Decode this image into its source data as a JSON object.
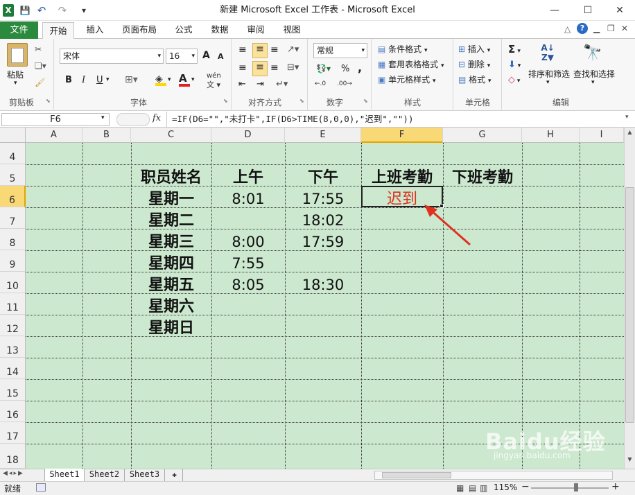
{
  "window": {
    "title": "新建 Microsoft Excel 工作表 - Microsoft Excel",
    "minimize": "—",
    "maximize": "☐",
    "close": "✕"
  },
  "qat": {
    "app_icon": "X",
    "save": "💾",
    "undo": "↶",
    "redo": "↷"
  },
  "tabs": {
    "file": "文件",
    "items": [
      "开始",
      "插入",
      "页面布局",
      "公式",
      "数据",
      "审阅",
      "视图"
    ]
  },
  "ribbon": {
    "clipboard": {
      "paste": "粘贴",
      "label": "剪贴板"
    },
    "font": {
      "name": "宋体",
      "size": "16",
      "bold": "B",
      "italic": "I",
      "underline": "U",
      "grow": "A",
      "shrink": "A",
      "wen": "wén",
      "label": "字体"
    },
    "alignment": {
      "label": "对齐方式"
    },
    "number": {
      "format": "常规",
      "percent": "%",
      "comma": ",",
      "inc": "←.0",
      "dec": ".00→",
      "label": "数字"
    },
    "styles": {
      "conditional": "条件格式",
      "table": "套用表格格式",
      "cell": "单元格样式",
      "label": "样式"
    },
    "cells": {
      "insert": "插入",
      "delete": "删除",
      "format": "格式",
      "label": "单元格"
    },
    "editing": {
      "sum": "Σ",
      "sort": "排序和筛选",
      "find": "查找和选择",
      "label": "编辑"
    }
  },
  "formula_bar": {
    "name_box": "F6",
    "fx": "fx",
    "formula": "=IF(D6=\"\",\"未打卡\",IF(D6>TIME(8,0,0),\"迟到\",\"\"))"
  },
  "sheet": {
    "columns": [
      "A",
      "B",
      "C",
      "D",
      "E",
      "F",
      "G",
      "H",
      "I"
    ],
    "rows": [
      "4",
      "5",
      "6",
      "7",
      "8",
      "9",
      "10",
      "11",
      "12",
      "13",
      "14",
      "15",
      "16",
      "17",
      "18"
    ],
    "headers": {
      "name": "职员姓名",
      "am": "上午",
      "pm": "下午",
      "in": "上班考勤",
      "out": "下班考勤"
    },
    "data": [
      {
        "day": "星期一",
        "am": "8:01",
        "pm": "17:55",
        "in": "迟到"
      },
      {
        "day": "星期二",
        "am": "",
        "pm": "18:02",
        "in": ""
      },
      {
        "day": "星期三",
        "am": "8:00",
        "pm": "17:59",
        "in": ""
      },
      {
        "day": "星期四",
        "am": "7:55",
        "pm": "",
        "in": ""
      },
      {
        "day": "星期五",
        "am": "8:05",
        "pm": "18:30",
        "in": ""
      },
      {
        "day": "星期六",
        "am": "",
        "pm": "",
        "in": ""
      },
      {
        "day": "星期日",
        "am": "",
        "pm": "",
        "in": ""
      }
    ],
    "active_cell": "F6",
    "colors": {
      "background": "#cce8cf",
      "late_text": "#e0301e",
      "arrow": "#e0301e",
      "selected_col": "#f9d976"
    }
  },
  "sheet_tabs": [
    "Sheet1",
    "Sheet2",
    "Sheet3"
  ],
  "status": {
    "ready": "就绪",
    "zoom": "115%",
    "minus": "−",
    "plus": "+"
  },
  "watermark": "Baidu经验 jingyan.baidu.com"
}
